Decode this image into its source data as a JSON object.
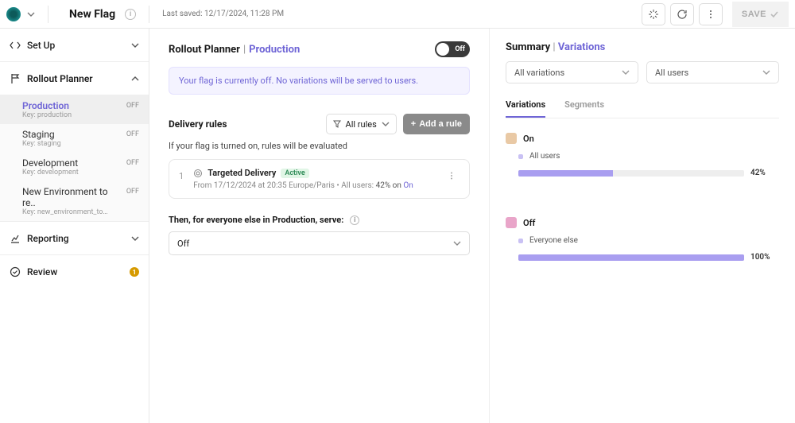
{
  "header": {
    "title": "New Flag",
    "last_saved": "Last saved: 12/17/2024, 11:28 PM",
    "save_label": "SAVE"
  },
  "sidebar": {
    "setup_label": "Set Up",
    "rollout_label": "Rollout Planner",
    "reporting_label": "Reporting",
    "review_label": "Review",
    "review_count": "1",
    "environments": [
      {
        "label": "Production",
        "key": "Key: production",
        "badge": "OFF"
      },
      {
        "label": "Staging",
        "key": "Key: staging",
        "badge": "OFF"
      },
      {
        "label": "Development",
        "key": "Key: development",
        "badge": "OFF"
      },
      {
        "label": "New Environment to re..",
        "key": "Key: new_environment_to_re..",
        "badge": "OFF"
      }
    ]
  },
  "center": {
    "breadcrumb_label": "Rollout Planner",
    "breadcrumb_sep": "|",
    "breadcrumb_env": "Production",
    "toggle_label": "Off",
    "notice": "Your flag is currently off. No variations will be served to users.",
    "delivery_title": "Delivery rules",
    "all_rules_label": "All rules",
    "add_rule_label": "Add a rule",
    "hint": "If your flag is turned on, rules will be evaluated",
    "rule": {
      "num": "1",
      "name": "Targeted Delivery",
      "status": "Active",
      "desc_prefix": "From 17/12/2024 at 20:35 Europe/Paris",
      "desc_bullet": "•",
      "desc_users": "All users:",
      "desc_pct": "42% on",
      "desc_on": "On"
    },
    "then_label": "Then, for everyone else in Production, serve:",
    "default_variation": "Off"
  },
  "summary": {
    "title_prefix": "Summary",
    "title_sep": "|",
    "title_hi": "Variations",
    "filter_variations": "All variations",
    "filter_users": "All users",
    "tabs": {
      "variations": "Variations",
      "segments": "Segments"
    },
    "on": {
      "label": "On",
      "segment_label": "All users",
      "pct": "42%",
      "fill": "42%"
    },
    "off": {
      "label": "Off",
      "segment_label": "Everyone else",
      "pct": "100%",
      "fill": "100%"
    }
  }
}
